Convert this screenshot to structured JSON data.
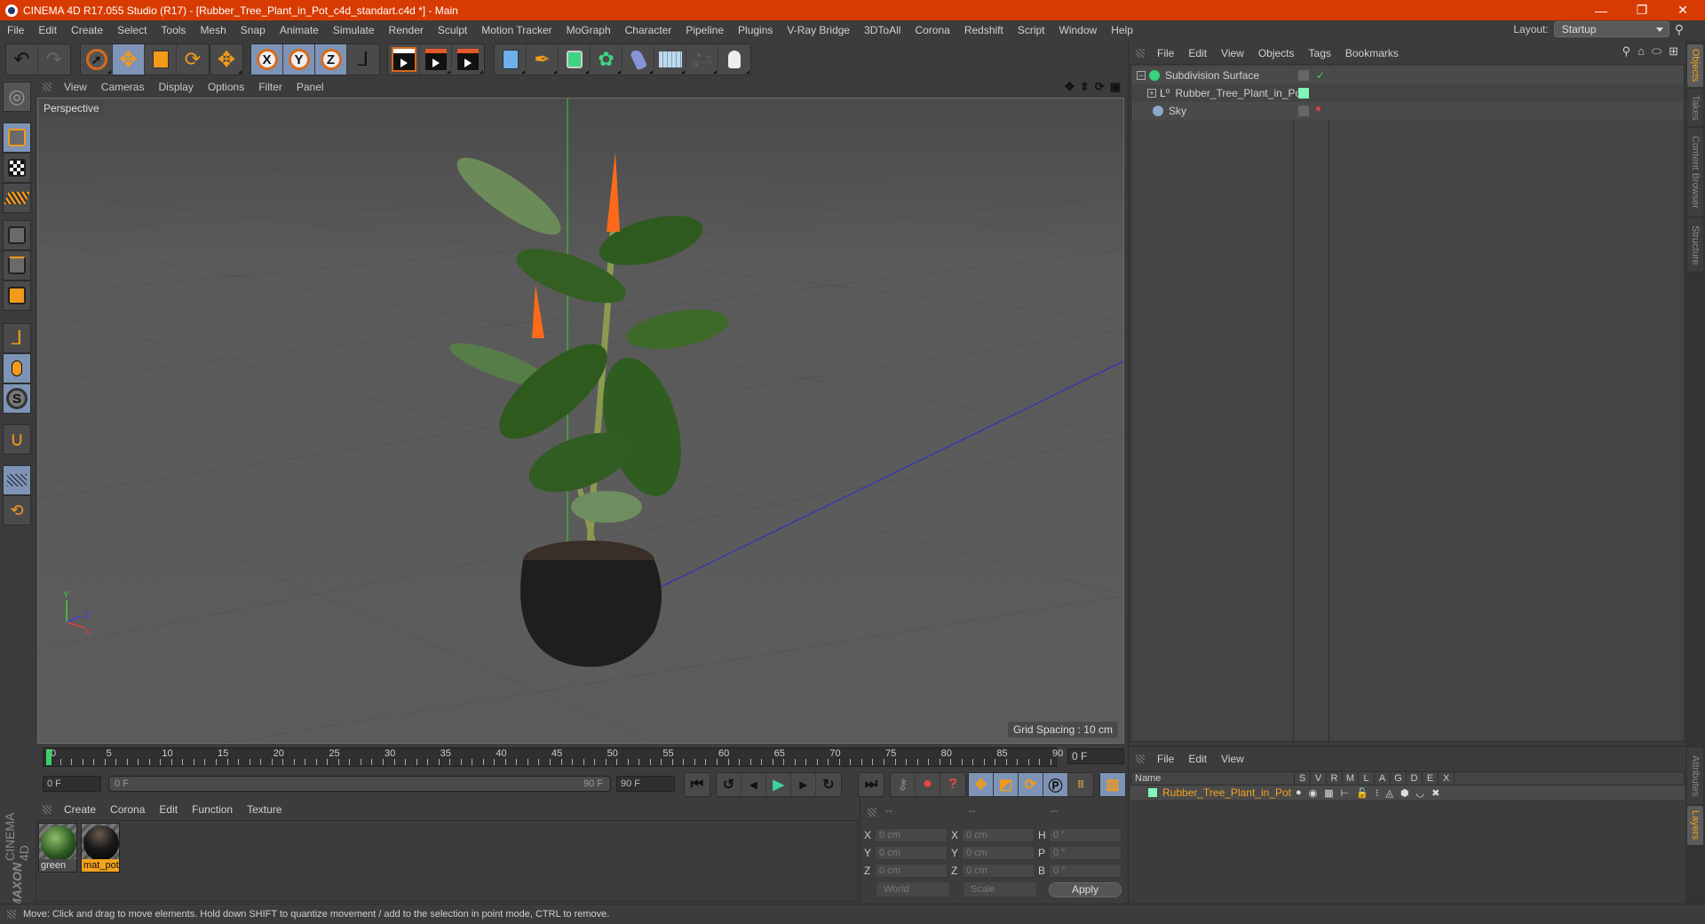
{
  "window": {
    "title": "CINEMA 4D R17.055 Studio (R17) - [Rubber_Tree_Plant_in_Pot_c4d_standart.c4d *] - Main",
    "controls": {
      "minimize": "—",
      "maximize": "❐",
      "close": "✕"
    }
  },
  "menubar": [
    "File",
    "Edit",
    "Create",
    "Select",
    "Tools",
    "Mesh",
    "Snap",
    "Animate",
    "Simulate",
    "Render",
    "Sculpt",
    "Motion Tracker",
    "MoGraph",
    "Character",
    "Pipeline",
    "Plugins",
    "V-Ray Bridge",
    "3DToAll",
    "Corona",
    "Redshift",
    "Script",
    "Window",
    "Help"
  ],
  "layout": {
    "label": "Layout:",
    "value": "Startup"
  },
  "toolbar": {
    "axis_x": "X",
    "axis_y": "Y",
    "axis_z": "Z",
    "groups": [
      [
        "undo-icon",
        "redo-icon"
      ],
      [
        "selection-arrow-icon",
        "move-icon",
        "scale-icon",
        "rotate-icon"
      ],
      [
        "last-tool-move-icon"
      ],
      [
        "x-axis-lock-icon",
        "y-axis-lock-icon",
        "z-axis-lock-icon",
        "coordinate-system-icon"
      ],
      [
        "render-view-icon",
        "render-picture-viewer-icon",
        "render-settings-icon"
      ],
      [
        "cube-primitive-icon",
        "pen-spline-icon",
        "subdivision-surface-icon",
        "cloner-icon",
        "deformer-icon",
        "floor-scene-icon",
        "camera-icon",
        "light-icon"
      ]
    ]
  },
  "left_toolbar": [
    "make-editable-icon",
    "model-mode-icon",
    "texture-mode-icon",
    "workplane-mode-icon",
    "points-mode-icon",
    "edges-mode-icon",
    "polygons-mode-icon",
    "axis-mode-icon",
    "tweak-mode-icon",
    "solo-mode-icon",
    "snap-magnet-icon",
    "workplane-lock-icon",
    "workplane-align-icon"
  ],
  "viewport": {
    "menu": [
      "View",
      "Cameras",
      "Display",
      "Options",
      "Filter",
      "Panel"
    ],
    "camera_label": "Perspective",
    "grid_spacing": "Grid Spacing : 10 cm",
    "axis_labels": {
      "y": "Y",
      "z": "Z",
      "x": "X"
    }
  },
  "object_manager": {
    "menu": [
      "File",
      "Edit",
      "View",
      "Objects",
      "Tags",
      "Bookmarks"
    ],
    "objects": [
      {
        "name": "Subdivision Surface",
        "icon": "subdivision-surface-icon",
        "expand": "−",
        "check": "✓"
      },
      {
        "name": "Rubber_Tree_Plant_in_Pot",
        "icon": "null-object-icon",
        "expand": "+",
        "color": "#7ff5b8"
      },
      {
        "name": "Sky",
        "icon": "sky-icon"
      }
    ]
  },
  "side_tabs_top": [
    "Objects",
    "Takes",
    "Content Browser",
    "Structure"
  ],
  "side_tabs_bottom": [
    "Attributes",
    "Layers"
  ],
  "timeline": {
    "ticks": [
      "0",
      "5",
      "10",
      "15",
      "20",
      "25",
      "30",
      "35",
      "40",
      "45",
      "50",
      "55",
      "60",
      "65",
      "70",
      "75",
      "80",
      "85",
      "90"
    ],
    "current_frame": "0 F",
    "start_field": "0 F",
    "range_start": "0 F",
    "range_end": "90 F",
    "end_field": "90 F",
    "playhead_fraction": 0
  },
  "material_manager": {
    "menu": [
      "Create",
      "Corona",
      "Edit",
      "Function",
      "Texture"
    ],
    "materials": [
      {
        "name": "green",
        "selected": false
      },
      {
        "name": "mat_pot",
        "selected": true
      }
    ]
  },
  "maxon_logo": {
    "brand": "MAXON",
    "product": "CINEMA 4D"
  },
  "coordinates": {
    "headers": [
      "--",
      "--",
      "--"
    ],
    "rows": [
      {
        "pos_label": "X",
        "pos": "0 cm",
        "size_label": "X",
        "size": "0 cm",
        "rot_label": "H",
        "rot": "0 °"
      },
      {
        "pos_label": "Y",
        "pos": "0 cm",
        "size_label": "Y",
        "size": "0 cm",
        "rot_label": "P",
        "rot": "0 °"
      },
      {
        "pos_label": "Z",
        "pos": "0 cm",
        "size_label": "Z",
        "size": "0 cm",
        "rot_label": "B",
        "rot": "0 °"
      }
    ],
    "space": "World",
    "mode": "Scale",
    "apply": "Apply"
  },
  "layer_manager": {
    "menu": [
      "File",
      "Edit",
      "View"
    ],
    "columns": [
      "Name",
      "S",
      "V",
      "R",
      "M",
      "L",
      "A",
      "G",
      "D",
      "E",
      "X"
    ],
    "rows": [
      {
        "name": "Rubber_Tree_Plant_in_Pot",
        "color": "#7ff5b8"
      }
    ]
  },
  "status": "Move: Click and drag to move elements. Hold down SHIFT to quantize movement / add to the selection in point mode, CTRL to remove."
}
